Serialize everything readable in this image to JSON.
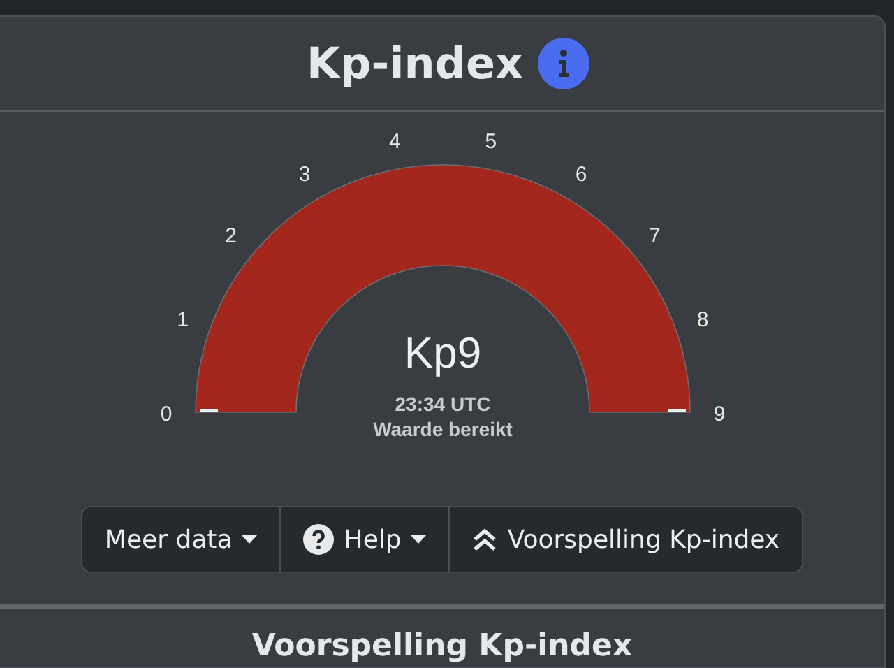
{
  "card": {
    "title": "Kp-index"
  },
  "gauge": {
    "value_label": "Kp9",
    "time": "23:34 UTC",
    "status": "Waarde bereikt",
    "scale": [
      "0",
      "1",
      "2",
      "3",
      "4",
      "5",
      "6",
      "7",
      "8",
      "9"
    ]
  },
  "buttons": [
    {
      "label": "Meer data",
      "kind": "dropdown"
    },
    {
      "label": "Help",
      "kind": "help"
    },
    {
      "label": "Voorspelling Kp-index",
      "kind": "jump"
    }
  ],
  "next_section": {
    "title": "Voorspelling Kp-index"
  }
}
